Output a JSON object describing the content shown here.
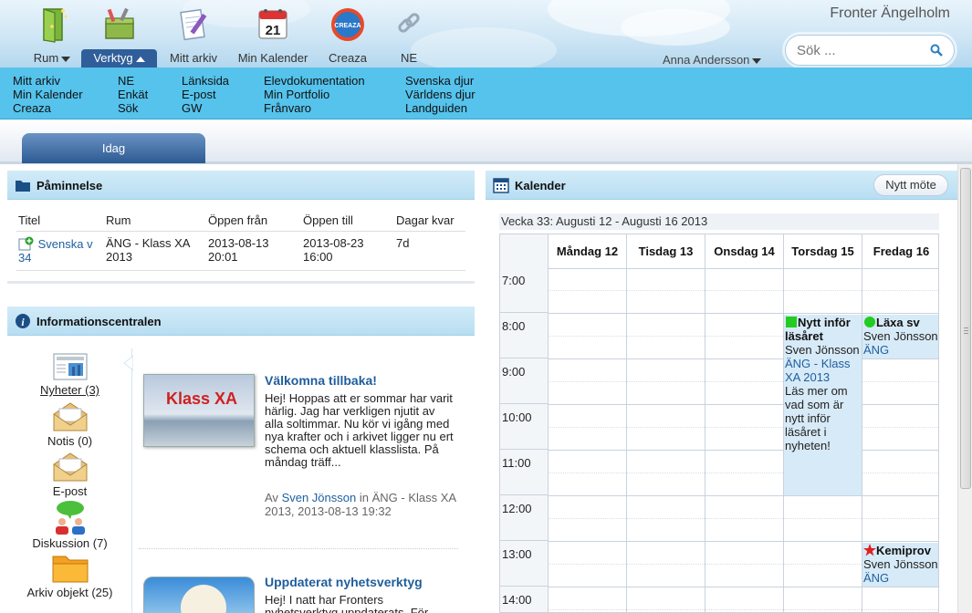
{
  "org_name": "Fronter Ängelholm",
  "user_name": "Anna Andersson",
  "search": {
    "placeholder": "Sök ..."
  },
  "nav": {
    "rum": "Rum",
    "verktyg": "Verktyg",
    "mitt_arkiv": "Mitt arkiv",
    "min_kalender": "Min Kalender",
    "creaza": "Creaza",
    "ne": "NE",
    "calendar_icon_day": "21",
    "creaza_icon_text": "CREAZA"
  },
  "submenu": {
    "col1": [
      "Mitt arkiv",
      "Min Kalender",
      "Creaza"
    ],
    "col2": [
      "NE",
      "Enkät",
      "Sök"
    ],
    "col3": [
      "Länksida",
      "E-post",
      "GW"
    ],
    "col4": [
      "Elevdokumentation",
      "Min Portfolio",
      "Frånvaro"
    ],
    "col5": [
      "Svenska djur",
      "Världens djur",
      "Landguiden"
    ]
  },
  "tab": {
    "label": "Idag"
  },
  "reminder": {
    "title": "Påminnelse",
    "columns": [
      "Titel",
      "Rum",
      "Öppen från",
      "Öppen till",
      "Dagar kvar"
    ],
    "row": {
      "title_link": "Svenska v",
      "title_cont": "34",
      "room": "ÄNG - Klass XA 2013",
      "from": "2013-08-13 20:01",
      "to": "2013-08-23 16:00",
      "days": "7d"
    }
  },
  "info": {
    "title": "Informationscentralen",
    "categories": [
      {
        "label": "Nyheter (3)"
      },
      {
        "label": "Notis (0)"
      },
      {
        "label": "E-post"
      },
      {
        "label": "Diskussion (7)"
      },
      {
        "label": "Arkiv objekt (25)"
      }
    ],
    "news": [
      {
        "title": "Välkomna tillbaka!",
        "image_text": "Klass XA",
        "text": "Hej! Hoppas att er sommar har varit härlig. Jag har verkligen njutit av alla soltimmar. Nu kör vi igång med nya krafter och i arkivet ligger nu ert schema och aktuell klasslista. På måndag träff...",
        "meta_prefix": "Av",
        "author": "Sven Jönsson",
        "meta_in": "in ÄNG - Klass XA 2013, 2013-08-13 19:32"
      },
      {
        "title": "Uppdaterat nyhetsverktyg",
        "text": "Hej! I natt har Fronters nyhetsverktyg uppdaterats. För"
      }
    ]
  },
  "calendar": {
    "title": "Kalender",
    "new_meeting": "Nytt möte",
    "week_label": "Vecka 33: Augusti 12 - Augusti 16 2013",
    "days": [
      "Måndag 12",
      "Tisdag 13",
      "Onsdag 14",
      "Torsdag 15",
      "Fredag 16"
    ],
    "hours": [
      "7:00",
      "8:00",
      "9:00",
      "10:00",
      "11:00",
      "12:00",
      "13:00",
      "14:00"
    ],
    "events": [
      {
        "day": "Torsdag 15",
        "start": "8:00",
        "end": "12:00",
        "title": "Nytt inför läsåret",
        "marker": "square",
        "marker_color": "#22cc22",
        "author": "Sven Jönsson",
        "room": "ÄNG - Klass XA 2013",
        "desc": "Läs mer om vad som är nytt inför läsåret i nyheten!"
      },
      {
        "day": "Fredag 16",
        "start": "8:00",
        "end": "9:00",
        "title": "Läxa sv",
        "marker": "circle",
        "marker_color": "#22cc22",
        "author": "Sven Jönsson",
        "room": "ÄNG"
      },
      {
        "day": "Fredag 16",
        "start": "13:00",
        "end": "14:00",
        "title": "Kemiprov",
        "marker": "star",
        "marker_color": "#e02020",
        "author": "Sven Jönsson",
        "room": "ÄNG"
      }
    ]
  }
}
